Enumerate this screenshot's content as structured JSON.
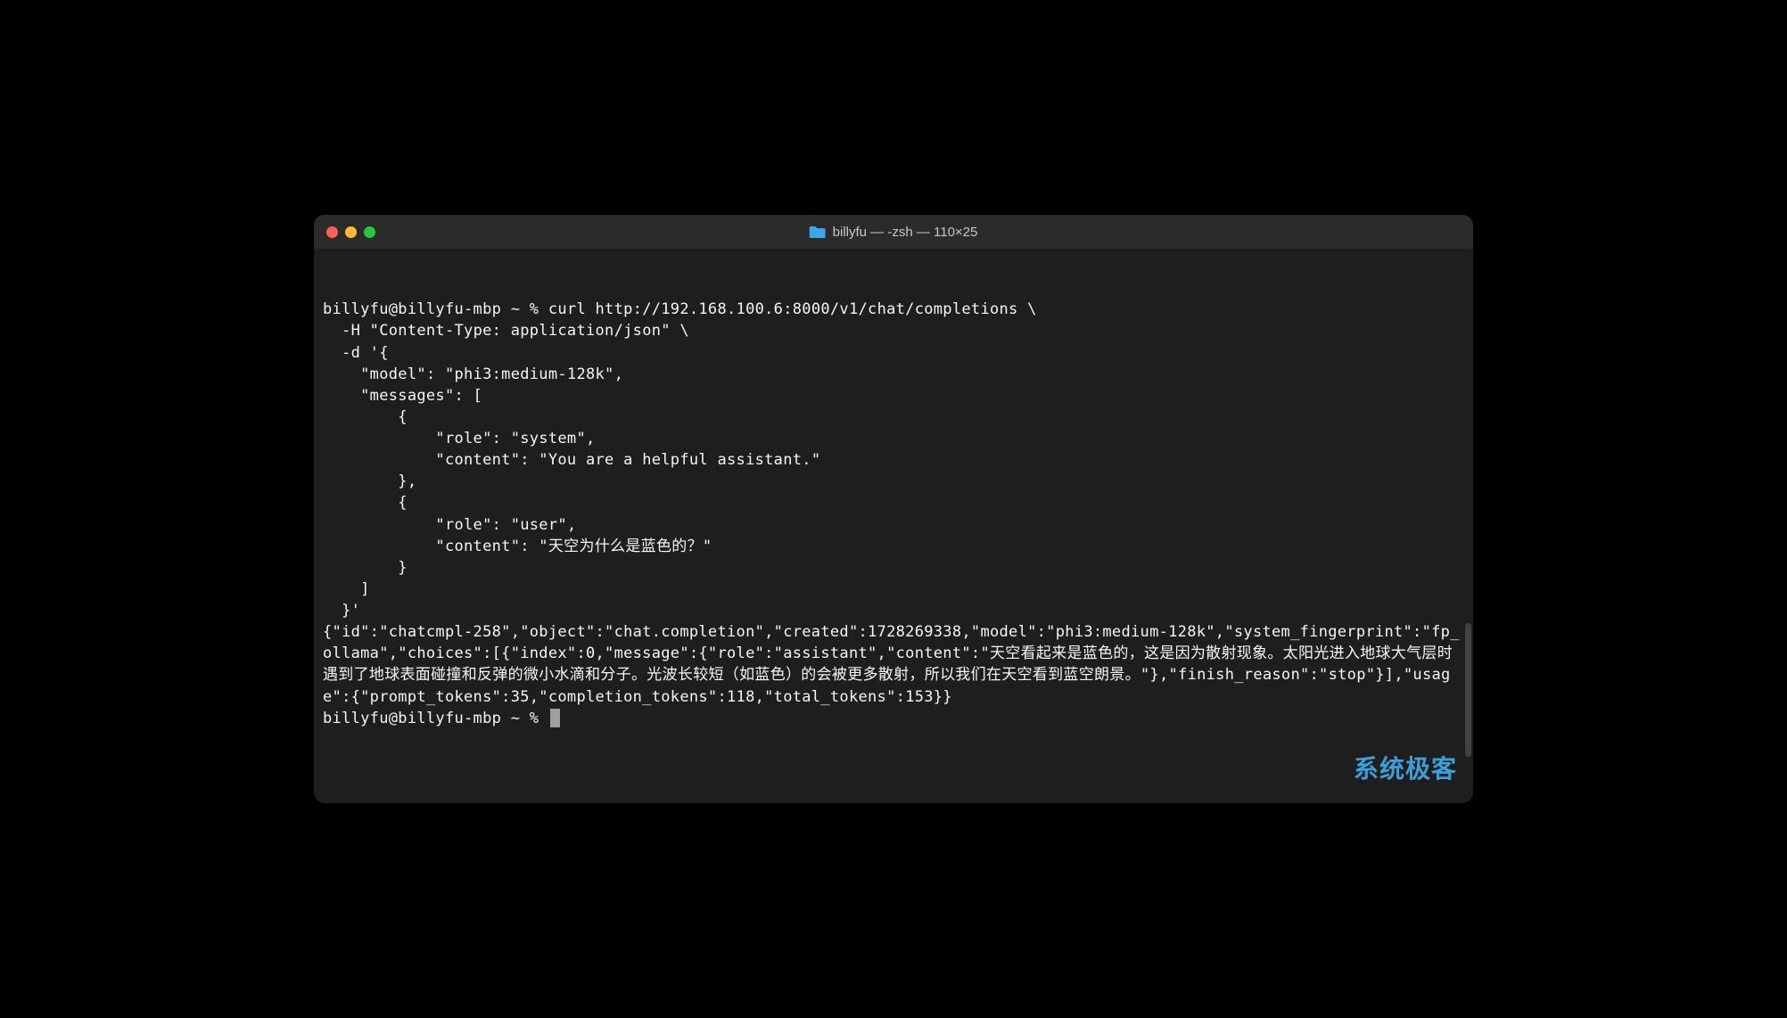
{
  "window": {
    "title": "billyfu — -zsh — 110×25",
    "folder_icon": "folder-icon"
  },
  "traffic_lights": {
    "close": "close",
    "minimize": "minimize",
    "maximize": "maximize"
  },
  "terminal": {
    "prompt1": "billyfu@billyfu-mbp ~ % ",
    "command": "curl http://192.168.100.6:8000/v1/chat/completions \\\n  -H \"Content-Type: application/json\" \\\n  -d '{\n    \"model\": \"phi3:medium-128k\",\n    \"messages\": [\n        {\n            \"role\": \"system\",\n            \"content\": \"You are a helpful assistant.\"\n        },\n        {\n            \"role\": \"user\",\n            \"content\": \"天空为什么是蓝色的？\"\n        }\n    ]\n  }'",
    "response": "{\"id\":\"chatcmpl-258\",\"object\":\"chat.completion\",\"created\":1728269338,\"model\":\"phi3:medium-128k\",\"system_fingerprint\":\"fp_ollama\",\"choices\":[{\"index\":0,\"message\":{\"role\":\"assistant\",\"content\":\"天空看起来是蓝色的，这是因为散射现象。太阳光进入地球大气层时遇到了地球表面碰撞和反弹的微小水滴和分子。光波长较短（如蓝色）的会被更多散射，所以我们在天空看到蓝空朗景。\"},\"finish_reason\":\"stop\"}],\"usage\":{\"prompt_tokens\":35,\"completion_tokens\":118,\"total_tokens\":153}}",
    "prompt2": "billyfu@billyfu-mbp ~ % "
  },
  "watermark": {
    "text": "系统极客"
  }
}
